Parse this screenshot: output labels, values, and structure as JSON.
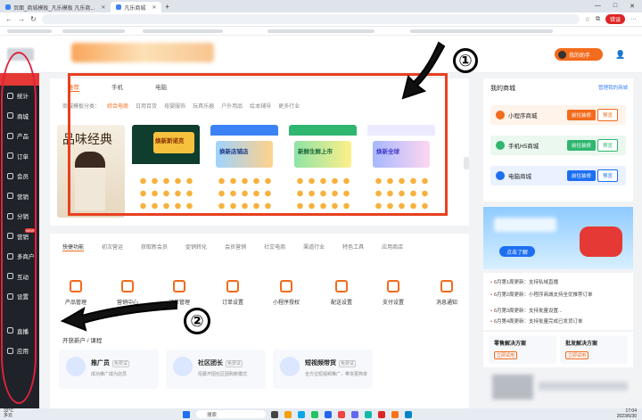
{
  "browser": {
    "tabs": [
      {
        "label": "页面_商城模板_凡乐模板 凡乐商...",
        "active": false
      },
      {
        "label": "凡乐商城",
        "active": true
      }
    ],
    "new_tab": "+",
    "window_controls": [
      "—",
      "□",
      "✕"
    ],
    "nav": [
      "←",
      "→",
      "↻"
    ],
    "url": "",
    "error_pill": "错误",
    "menu_icon": "···"
  },
  "header": {
    "user_label": "我的助手",
    "user_icon": "user-icon"
  },
  "sidebar": {
    "items": [
      {
        "label": "统计",
        "icon": "bar-chart-icon"
      },
      {
        "label": "商城",
        "icon": "store-icon"
      },
      {
        "label": "产品",
        "icon": "grid-icon"
      },
      {
        "label": "订单",
        "icon": "order-icon"
      },
      {
        "label": "会员",
        "icon": "member-icon"
      },
      {
        "label": "营销",
        "icon": "marketing-icon"
      },
      {
        "label": "分销",
        "icon": "distribution-icon"
      },
      {
        "label": "营销",
        "icon": "megaphone-icon",
        "badge": "NEW"
      },
      {
        "label": "多商户",
        "icon": "merchant-icon"
      },
      {
        "label": "互动",
        "icon": "interact-icon"
      },
      {
        "label": "设置",
        "icon": "settings-icon"
      },
      {
        "label": "直播",
        "icon": "live-icon"
      },
      {
        "label": "应用",
        "icon": "apps-icon"
      }
    ]
  },
  "templates": {
    "tabs": [
      {
        "label": "推荐",
        "active": true
      },
      {
        "label": "手机",
        "active": false
      },
      {
        "label": "电脑",
        "active": false
      }
    ],
    "categories_label": "商城模板分类：",
    "categories": [
      {
        "label": "综合电商",
        "active": true
      },
      {
        "label": "日用百货",
        "active": false
      },
      {
        "label": "母婴服饰",
        "active": false
      },
      {
        "label": "玩具乐器",
        "active": false
      },
      {
        "label": "户外用品",
        "active": false
      },
      {
        "label": "绘本辅导",
        "active": false
      },
      {
        "label": "更多行业",
        "active": false
      }
    ],
    "cards": [
      {
        "caption": "品味经典"
      },
      {
        "caption": "焕新斯诺克"
      },
      {
        "caption": "换新店铺店"
      },
      {
        "caption": "新鲜生鲜上市"
      },
      {
        "caption": "焕新全球"
      }
    ]
  },
  "annotations": {
    "one": "①",
    "two": "②"
  },
  "features": {
    "tabs": [
      {
        "label": "快捷功能",
        "active": true
      },
      {
        "label": "初次营运",
        "active": false
      },
      {
        "label": "获取新会员",
        "active": false
      },
      {
        "label": "促销转化",
        "active": false
      },
      {
        "label": "会员营销",
        "active": false
      },
      {
        "label": "社交电商",
        "active": false
      },
      {
        "label": "渠道行业",
        "active": false
      },
      {
        "label": "特色工具",
        "active": false
      },
      {
        "label": "应用商店",
        "active": false
      }
    ],
    "tools": [
      {
        "label": "产品管理"
      },
      {
        "label": "营销中心"
      },
      {
        "label": "订单管理"
      },
      {
        "label": "订单设置"
      },
      {
        "label": "小程序授权"
      },
      {
        "label": "配送设置"
      },
      {
        "label": "支付设置"
      },
      {
        "label": "消息通知"
      }
    ],
    "section_title": "开获新户 / 课程",
    "cards": [
      {
        "title": "推广员",
        "badge": "免费试",
        "desc": "成功推广成为店员"
      },
      {
        "title": "社区团长",
        "badge": "免费试",
        "desc": "招募开团社区团购新模式"
      },
      {
        "title": "短视频带货",
        "badge": "免费试",
        "desc": "全方位短视频推广，带货更简单"
      }
    ]
  },
  "right_panel": {
    "title": "我的商城",
    "link": "管理我的商城",
    "stores": [
      {
        "name": "小程序商城",
        "b1": "前往装修",
        "b2": "预览",
        "color": "#f36b1c"
      },
      {
        "name": "手机H5商城",
        "b1": "前往装修",
        "b2": "预览",
        "color": "#2fb66f"
      },
      {
        "name": "电脑商城",
        "b1": "前往装修",
        "b2": "预览",
        "color": "#1d6ff2"
      }
    ],
    "promo_button": "点击了解",
    "news": [
      "6月第1周更新：支持私域直播",
      "6月第2周更新：小程序商城支持全优推荐订单",
      "6月第3周更新：支持批量设置...",
      "6月第4周更新：支持批量完成已发货订单"
    ],
    "solutions": [
      {
        "title": "零售解决方案",
        "button": "立即试用"
      },
      {
        "title": "批发解决方案",
        "button": "立即试用"
      }
    ]
  },
  "taskbar": {
    "weather_temp": "32°C",
    "weather_desc": "多云",
    "search_label": "搜索",
    "time": "17:04",
    "date": "2023/6/30"
  }
}
